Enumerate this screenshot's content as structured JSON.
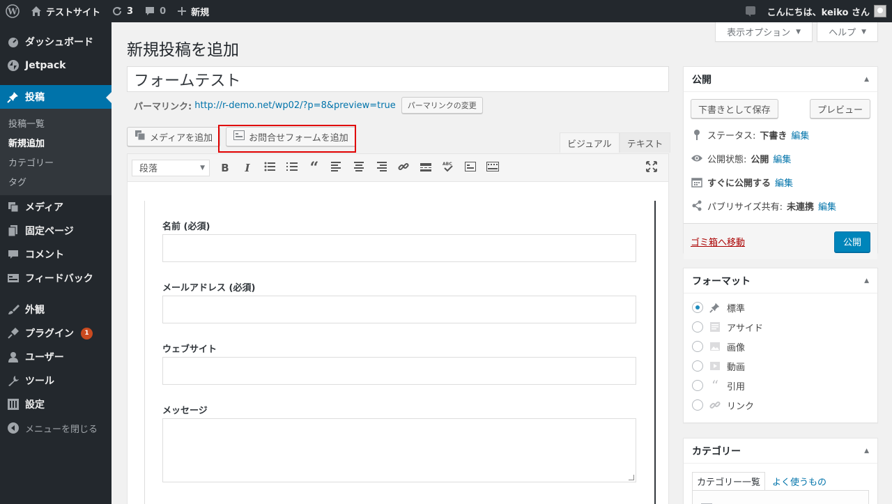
{
  "adminbar": {
    "site_name": "テストサイト",
    "updates_count": "3",
    "comments_count": "0",
    "new_label": "新規",
    "greeting": "こんにちは、keiko さん"
  },
  "sidebar": {
    "items": [
      {
        "label": "ダッシュボード",
        "icon": "dashboard-icon"
      },
      {
        "label": "Jetpack",
        "icon": "jetpack-icon"
      },
      {
        "label": "投稿",
        "icon": "pin-icon"
      },
      {
        "label": "メディア",
        "icon": "media-icon"
      },
      {
        "label": "固定ページ",
        "icon": "page-icon"
      },
      {
        "label": "コメント",
        "icon": "comment-icon"
      },
      {
        "label": "フィードバック",
        "icon": "feedback-icon"
      },
      {
        "label": "外観",
        "icon": "brush-icon"
      },
      {
        "label": "プラグイン",
        "icon": "plugin-icon",
        "badge": "1"
      },
      {
        "label": "ユーザー",
        "icon": "user-icon"
      },
      {
        "label": "ツール",
        "icon": "wrench-icon"
      },
      {
        "label": "設定",
        "icon": "settings-icon"
      },
      {
        "label": "メニューを閉じる",
        "icon": "collapse-icon"
      }
    ],
    "submenu": [
      "投稿一覧",
      "新規追加",
      "カテゴリー",
      "タグ"
    ]
  },
  "header": {
    "screen_options": "表示オプション",
    "help": "ヘルプ",
    "page_title": "新規投稿を追加"
  },
  "post": {
    "title": "フォームテスト",
    "permalink_label": "パーマリンク:",
    "permalink_url": "http://r-demo.net/wp02/?p=8&preview=true",
    "permalink_change": "パーマリンクの変更"
  },
  "editor": {
    "add_media": "メディアを追加",
    "add_contact_form": "お問合せフォームを追加",
    "tab_visual": "ビジュアル",
    "tab_text": "テキスト",
    "format_select": "段落"
  },
  "form": {
    "name_label": "名前 (必須)",
    "email_label": "メールアドレス (必須)",
    "website_label": "ウェブサイト",
    "message_label": "メッセージ"
  },
  "publish_box": {
    "title": "公開",
    "save_draft": "下書きとして保存",
    "preview": "プレビュー",
    "status_label": "ステータス:",
    "status_value": "下書き",
    "visibility_label": "公開状態:",
    "visibility_value": "公開",
    "schedule_label": "すぐに公開する",
    "publicize_label": "パブリサイズ共有:",
    "publicize_value": "未連携",
    "edit": "編集",
    "trash": "ゴミ箱へ移動",
    "publish": "公開"
  },
  "format_box": {
    "title": "フォーマット",
    "options": [
      "標準",
      "アサイド",
      "画像",
      "動画",
      "引用",
      "リンク"
    ]
  },
  "category_box": {
    "title": "カテゴリー",
    "tab_all": "カテゴリー一覧",
    "tab_popular": "よく使うもの"
  },
  "colors": {
    "admin_dark": "#23282d",
    "accent": "#0073aa",
    "highlight_red": "#e00000"
  }
}
